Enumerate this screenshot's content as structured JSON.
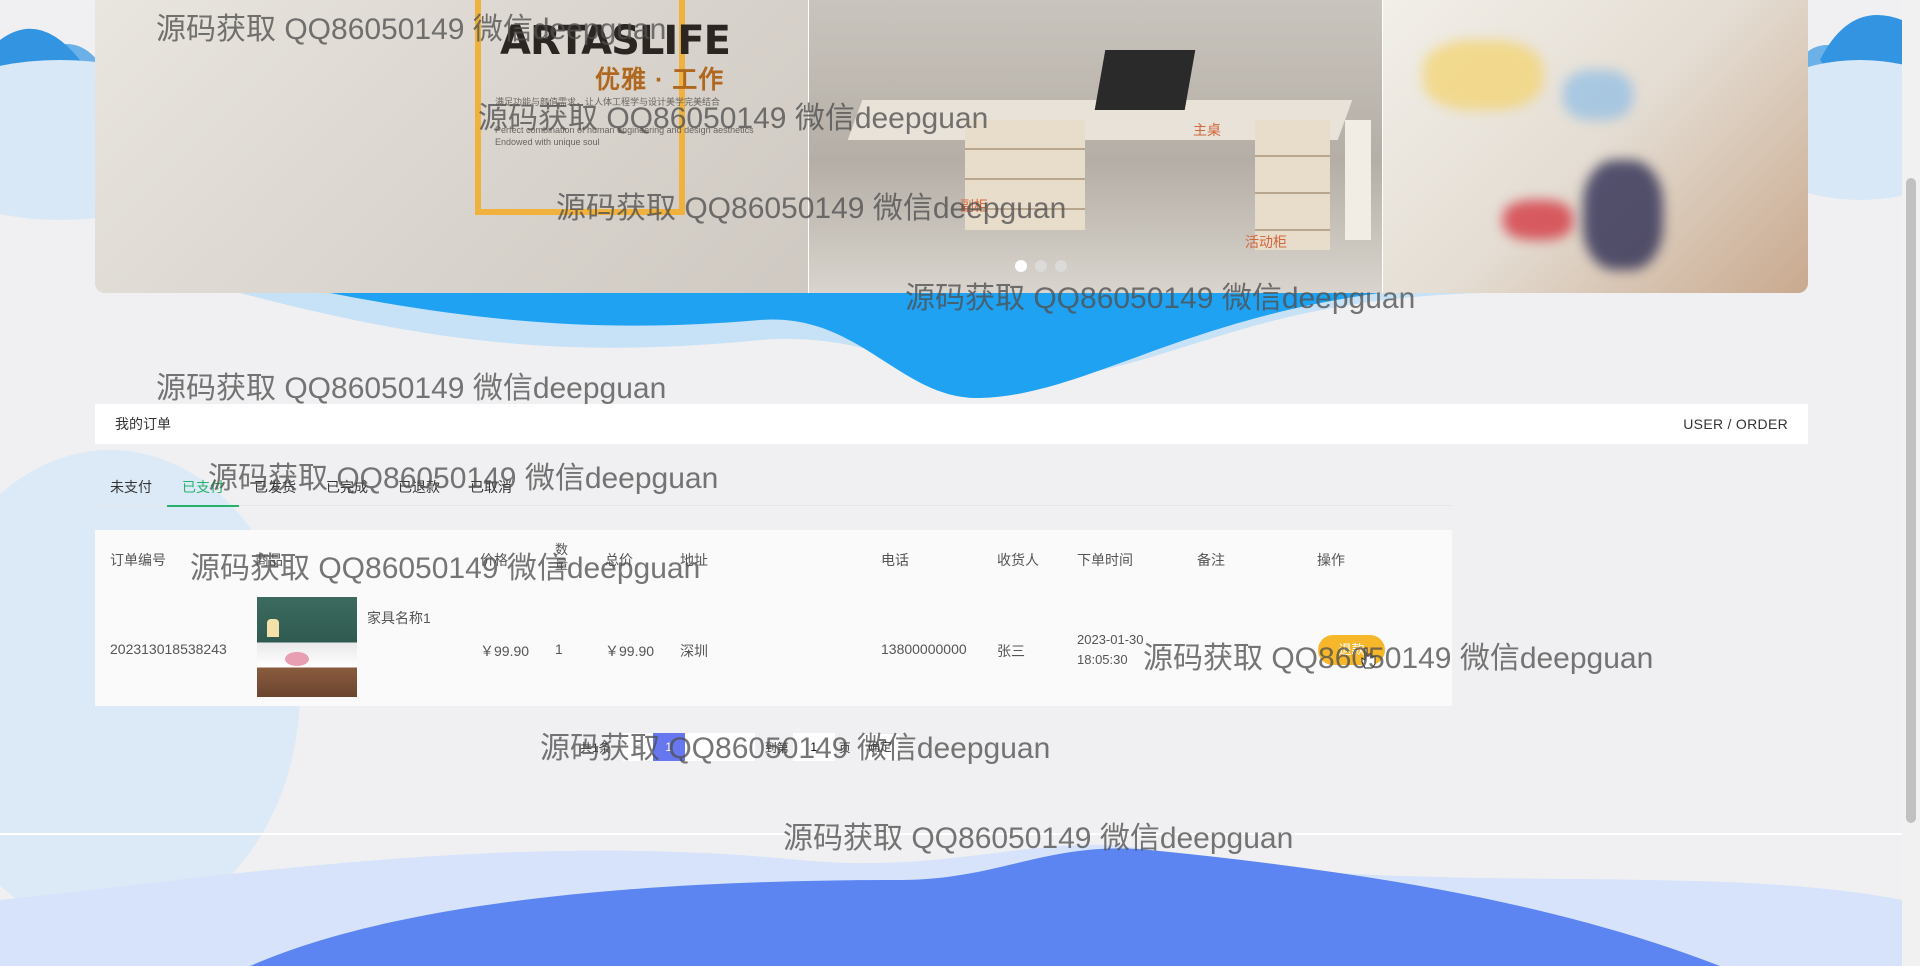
{
  "banner": {
    "brand_name": "ARTASLIFE",
    "brand_tagline": "优雅 · 工作",
    "brand_subtext": [
      "满足功能与颜值需求，让人体工程学与设计美学完美结合",
      "Perfect combination of human engineering and design aesthetics",
      "Endowed with unique soul"
    ],
    "labels": {
      "main_desk": "主桌",
      "side_cabinet": "副柜",
      "mobile_cabinet": "活动柜"
    },
    "carousel": {
      "slide_count": 3,
      "active_index": 0
    }
  },
  "breadcrumb": {
    "title": "我的订单",
    "path": "USER / ORDER"
  },
  "tabs": [
    {
      "label": "未支付",
      "active": false
    },
    {
      "label": "已支付",
      "active": true
    },
    {
      "label": "已发货",
      "active": false
    },
    {
      "label": "已完成",
      "active": false
    },
    {
      "label": "已退款",
      "active": false
    },
    {
      "label": "已取消",
      "active": false
    }
  ],
  "table": {
    "headers": {
      "order_no": "订单编号",
      "product": "商品",
      "price": "价格",
      "quantity": "数量",
      "total": "总价",
      "address": "地址",
      "phone": "电话",
      "receiver": "收货人",
      "order_time": "下单时间",
      "remark": "备注",
      "action": "操作"
    },
    "rows": [
      {
        "order_no": "202313018538243",
        "product_name": "家具名称1",
        "price": "￥99.90",
        "quantity": "1",
        "total": "￥99.90",
        "address": "深圳",
        "phone": "13800000000",
        "receiver": "张三",
        "order_time": "2023-01-30 18:05:30",
        "remark": "",
        "action_label": "退款"
      }
    ]
  },
  "pagination": {
    "total_text": "共1条",
    "prev": "<",
    "current_page": "1",
    "next": ">",
    "goto_label": "到第",
    "goto_value": "1",
    "page_suffix": "页",
    "confirm_label": "确定"
  },
  "watermark_text": "源码获取 QQ86050149 微信deepguan",
  "colors": {
    "accent_green": "#26b26b",
    "pay_button": "#f7b72a",
    "pager_active": "#6677f0",
    "wave_blue": "#1f9bf0"
  }
}
